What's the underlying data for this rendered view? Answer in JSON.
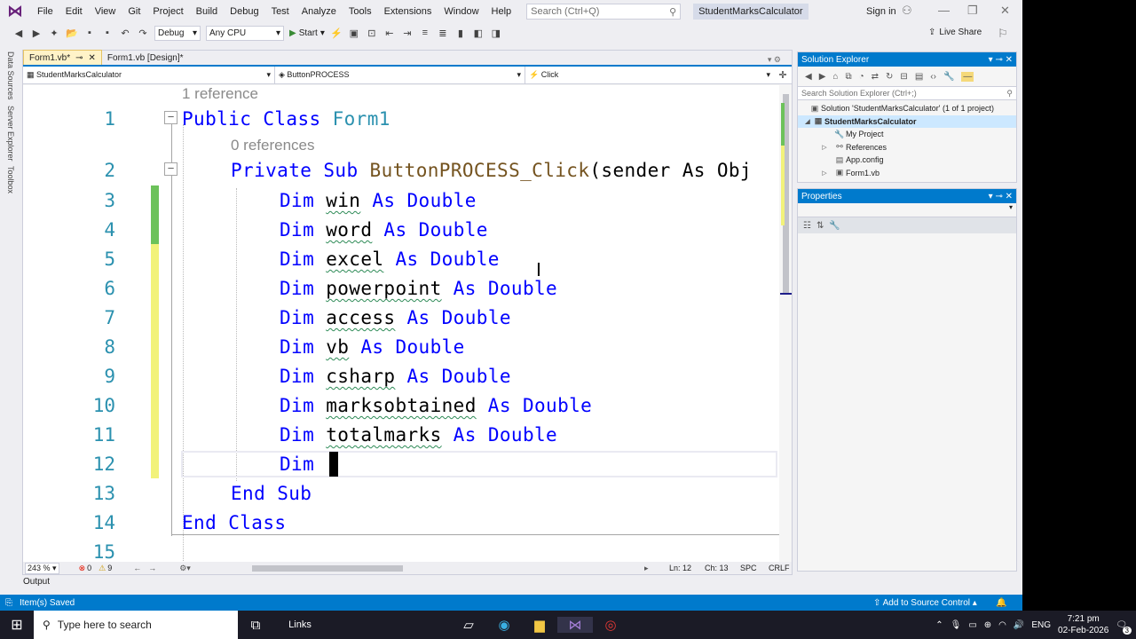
{
  "menu": [
    "File",
    "Edit",
    "View",
    "Git",
    "Project",
    "Build",
    "Debug",
    "Test",
    "Analyze",
    "Tools",
    "Extensions",
    "Window",
    "Help"
  ],
  "search": {
    "placeholder": "Search (Ctrl+Q)"
  },
  "solution_name": "StudentMarksCalculator",
  "signin": "Sign in",
  "toolbar": {
    "config": "Debug",
    "platform": "Any CPU",
    "start": "Start",
    "liveshare": "Live Share"
  },
  "left_tabs": [
    "Data Sources",
    "Server Explorer",
    "Toolbox"
  ],
  "doc_tabs": [
    {
      "label": "Form1.vb*",
      "active": true
    },
    {
      "label": "Form1.vb [Design]*",
      "active": false
    }
  ],
  "nav": {
    "project": "StudentMarksCalculator",
    "object": "ButtonPROCESS",
    "event": "Click"
  },
  "code": {
    "ref_class": "1 reference",
    "ref_sub": "0 references",
    "line_numbers": [
      "1",
      "2",
      "3",
      "4",
      "5",
      "6",
      "7",
      "8",
      "9",
      "10",
      "11",
      "12",
      "13",
      "14",
      "15"
    ],
    "kw_public": "Public",
    "kw_class": "Class",
    "class_name": "Form1",
    "kw_private": "Private",
    "kw_sub": "Sub",
    "method_name": "ButtonPROCESS_Click",
    "sub_params": "(sender As Obj",
    "kw_dim": "Dim",
    "kw_as": "As",
    "kw_double": "Double",
    "vars": [
      "win",
      "word",
      "excel",
      "powerpoint",
      "access",
      "vb",
      "csharp",
      "marksobtained",
      "totalmarks"
    ],
    "kw_end": "End"
  },
  "editor_status": {
    "zoom": "243 %",
    "errors": "0",
    "warnings": "9",
    "position": "Ln: 12",
    "column": "Ch: 13",
    "spc": "SPC",
    "crlf": "CRLF"
  },
  "output_tab": "Output",
  "solution_explorer": {
    "title": "Solution Explorer",
    "search_placeholder": "Search Solution Explorer (Ctrl+;)",
    "items": [
      {
        "label": "Solution 'StudentMarksCalculator' (1 of 1 project)",
        "indent": 0,
        "arrow": "",
        "icon": "S"
      },
      {
        "label": "StudentMarksCalculator",
        "indent": 1,
        "arrow": "◢",
        "icon": "VB",
        "selected": true
      },
      {
        "label": "My Project",
        "indent": 2,
        "arrow": "",
        "icon": "🔧"
      },
      {
        "label": "References",
        "indent": 2,
        "arrow": "▷",
        "icon": "⚯"
      },
      {
        "label": "App.config",
        "indent": 2,
        "arrow": "",
        "icon": "▤"
      },
      {
        "label": "Form1.vb",
        "indent": 2,
        "arrow": "▷",
        "icon": "▣"
      }
    ]
  },
  "properties": {
    "title": "Properties"
  },
  "statusbar": {
    "message": "Item(s) Saved",
    "source_control": "Add to Source Control"
  },
  "taskbar": {
    "search_placeholder": "Type here to search",
    "links": "Links",
    "lang": "ENG",
    "time": "7:21 pm",
    "date": "02-Feb-2026",
    "notif_count": "3"
  }
}
